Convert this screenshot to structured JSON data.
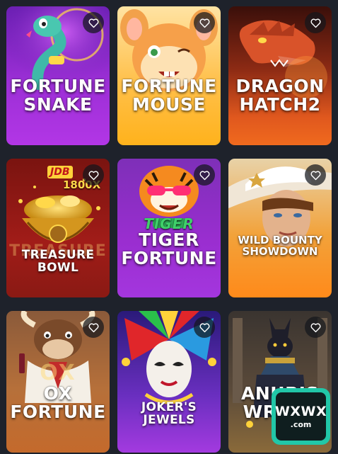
{
  "games": [
    {
      "id": "fortune-snake",
      "lines": [
        "FORTUNE",
        "SNAKE"
      ]
    },
    {
      "id": "fortune-mouse",
      "lines": [
        "FORTUNE",
        "MOUSE"
      ]
    },
    {
      "id": "dragon-hatch2",
      "lines": [
        "DRAGON",
        "HATCH2"
      ]
    },
    {
      "id": "treasure-bowl",
      "lines": [
        "TREASURE",
        "BOWL"
      ],
      "badge": "JDB",
      "multiplier": "1800X",
      "ghost": "TREASURE"
    },
    {
      "id": "tiger-fortune",
      "lines": [
        "TIGER",
        "FORTUNE"
      ],
      "ghost": "TIGER"
    },
    {
      "id": "wild-bounty-showdown",
      "lines": [
        "WILD BOUNTY",
        "SHOWDOWN"
      ]
    },
    {
      "id": "ox-fortune",
      "lines": [
        "OX",
        "FORTUNE"
      ],
      "ghost": "OX"
    },
    {
      "id": "jokers-jewels",
      "lines": [
        "JOKER'S",
        "JEWELS"
      ]
    },
    {
      "id": "anubis-wrath",
      "lines": [
        "ANUBIS",
        "WRATH"
      ]
    }
  ],
  "favorite_icon": "heart-outline-icon",
  "site_logo": {
    "main": "WXWX",
    "sub": ".com"
  },
  "colors": {
    "background": "#1e222b",
    "logo_accent": "#21c7a8"
  }
}
